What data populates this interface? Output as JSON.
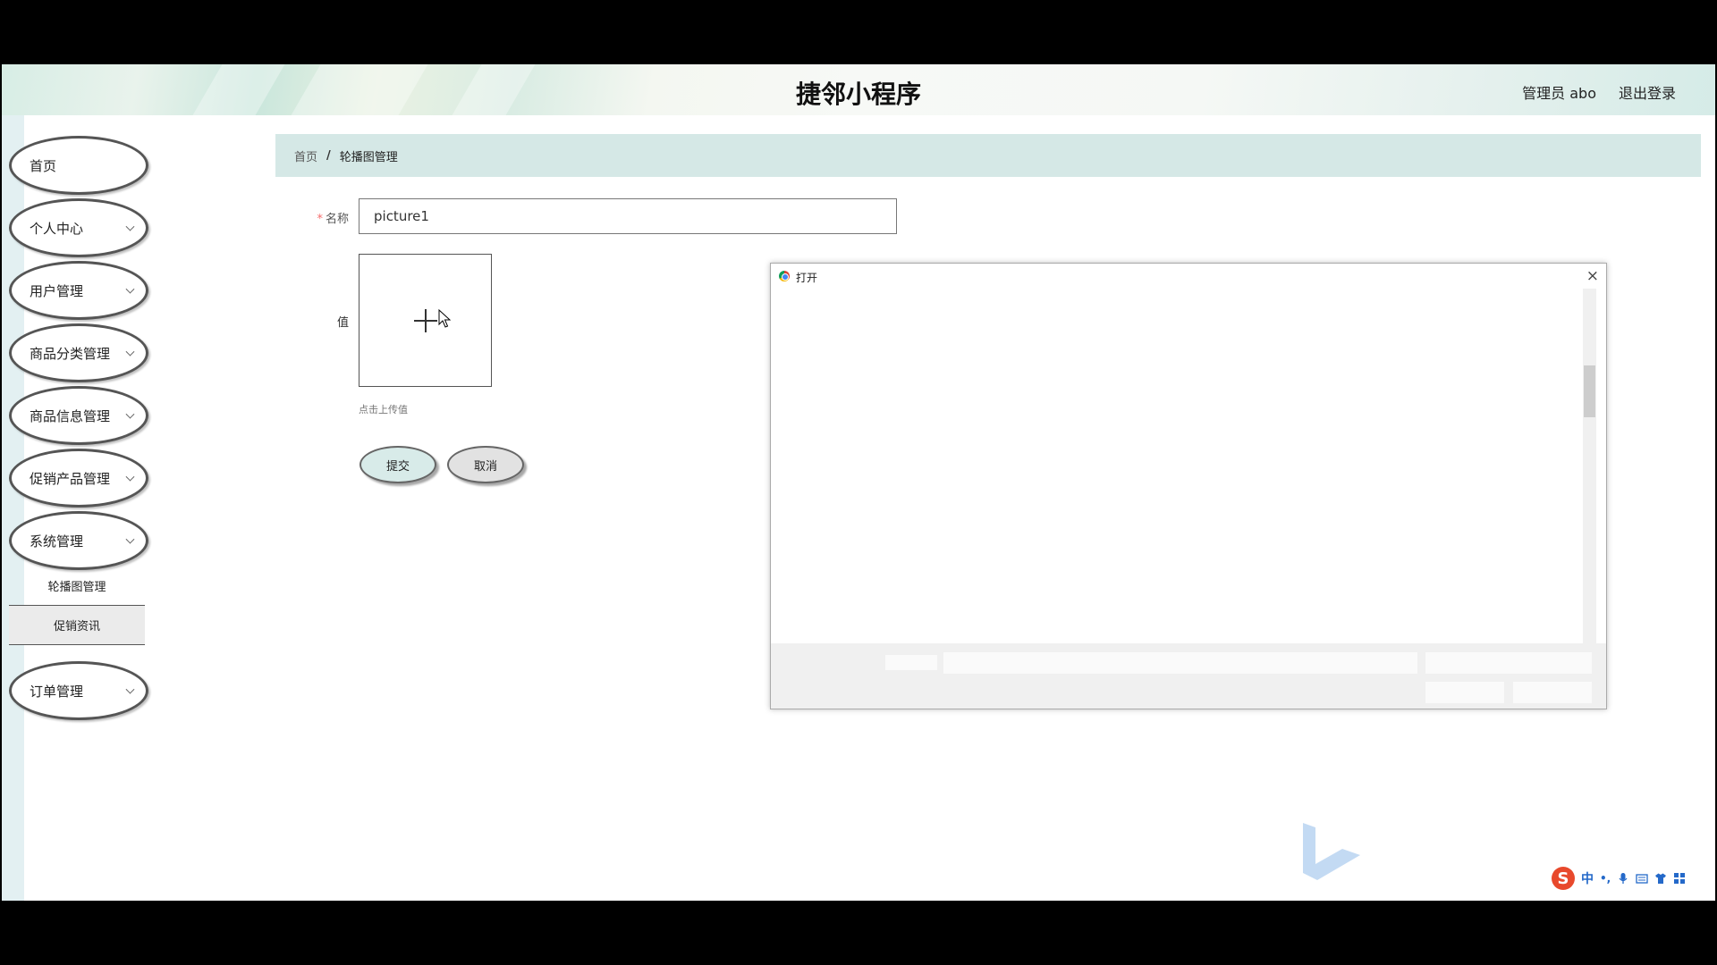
{
  "header": {
    "title": "捷邻小程序",
    "user": "管理员 abo",
    "logout": "退出登录"
  },
  "sidebar": {
    "items": [
      {
        "label": "首页"
      },
      {
        "label": "个人中心"
      },
      {
        "label": "用户管理"
      },
      {
        "label": "商品分类管理"
      },
      {
        "label": "商品信息管理"
      },
      {
        "label": "促销产品管理"
      },
      {
        "label": "系统管理"
      },
      {
        "label": "订单管理"
      }
    ],
    "sub_items": [
      {
        "label": "轮播图管理"
      },
      {
        "label": "促销资讯"
      }
    ]
  },
  "breadcrumb": {
    "home": "首页",
    "separator": "/",
    "current": "轮播图管理"
  },
  "form": {
    "name_label": "名称",
    "required_mark": "*",
    "name_value": "picture1",
    "value_label": "值",
    "upload_tip": "点击上传值",
    "submit": "提交",
    "cancel": "取消"
  },
  "dialog": {
    "title": "打开",
    "close": "×"
  },
  "ime": {
    "logo": "S",
    "mode": "中",
    "punct": "•,"
  },
  "colors": {
    "breadcrumb_bg": "#d5e8e6",
    "submit_bg": "#d8ebe9",
    "cancel_bg": "#e2e2e2",
    "required": "#f56c6c"
  }
}
